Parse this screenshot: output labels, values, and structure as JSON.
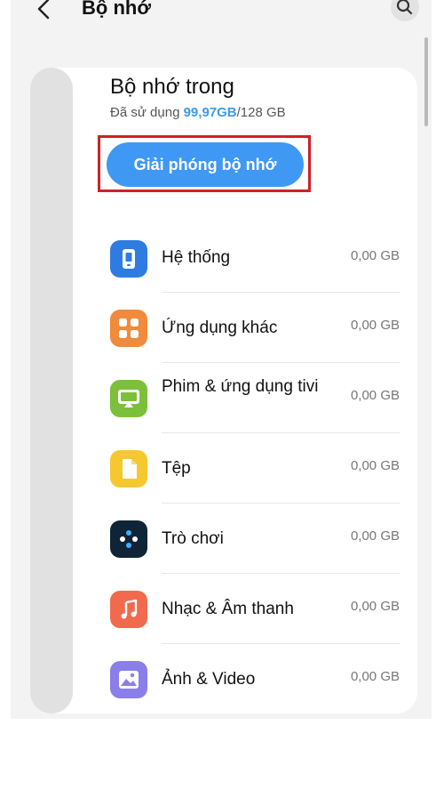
{
  "header": {
    "title": "Bộ nhớ"
  },
  "storage": {
    "title": "Bộ nhớ trong",
    "used_prefix": "Đã sử dụng ",
    "used": "99,97GB",
    "total": "/128 GB"
  },
  "free_button": "Giải phóng bộ nhớ",
  "items": [
    {
      "label": "Hệ thống",
      "size": "0,00 GB",
      "icon": "phone-icon",
      "color": "#2f7ce0"
    },
    {
      "label": "Ứng dụng khác",
      "size": "0,00 GB",
      "icon": "apps-grid-icon",
      "color": "#f08a3c"
    },
    {
      "label": "Phim & ứng dụng tivi",
      "size": "0,00 GB",
      "icon": "tv-icon",
      "color": "#7cbf3a"
    },
    {
      "label": "Tệp",
      "size": "0,00 GB",
      "icon": "file-icon",
      "color": "#f6c830"
    },
    {
      "label": "Trò chơi",
      "size": "0,00 GB",
      "icon": "game-icon",
      "color": "#0f2436"
    },
    {
      "label": "Nhạc & Âm thanh",
      "size": "0,00 GB",
      "icon": "music-icon",
      "color": "#f16a4d"
    },
    {
      "label": "Ảnh & Video",
      "size": "0,00 GB",
      "icon": "photo-icon",
      "color": "#8a7fe8"
    }
  ]
}
